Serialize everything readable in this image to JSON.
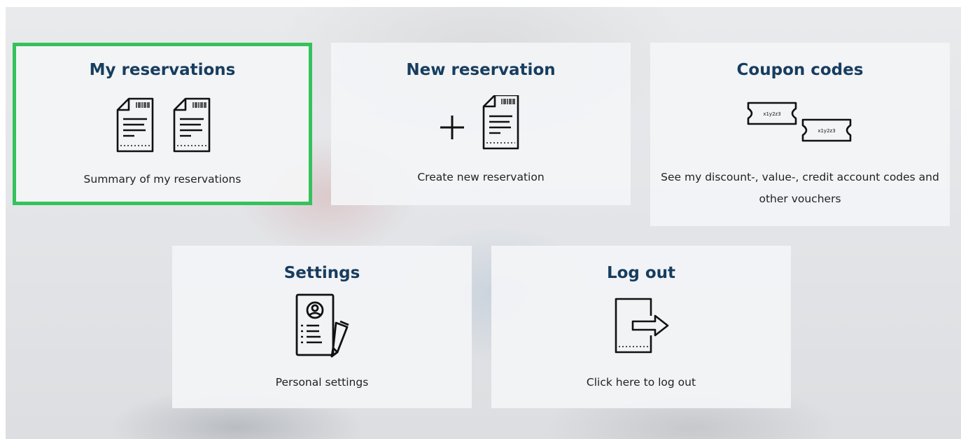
{
  "tiles": {
    "my_reservations": {
      "title": "My reservations",
      "description": "Summary of my reservations",
      "icon": "documents-icon",
      "selected": true
    },
    "new_reservation": {
      "title": "New reservation",
      "description": "Create new reservation",
      "icon": "add-document-icon"
    },
    "coupon_codes": {
      "title": "Coupon codes",
      "description": "See my discount-, value-, credit account codes and other vouchers",
      "icon": "tickets-icon",
      "ticket_code": "x1y2z3"
    },
    "settings": {
      "title": "Settings",
      "description": "Personal settings",
      "icon": "profile-edit-icon"
    },
    "logout": {
      "title": "Log out",
      "description": "Click here to log out",
      "icon": "logout-icon"
    }
  },
  "colors": {
    "title": "#173d5f",
    "selected_border": "#34c25a",
    "tile_background": "#f3f4f6"
  }
}
